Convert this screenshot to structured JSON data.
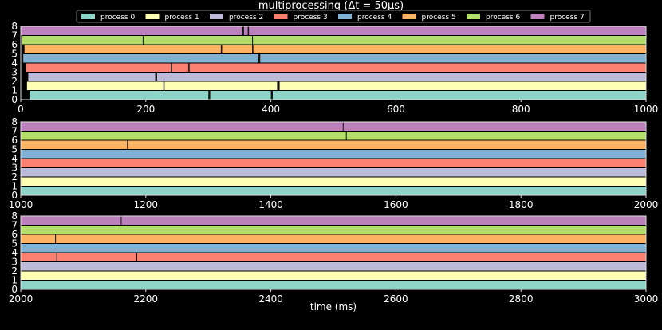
{
  "chart_data": {
    "type": "timeline",
    "title": "multiprocessing (Δt = 50μs)",
    "xlabel": "time (ms)",
    "legend": {
      "placement": "top-center",
      "entries": [
        "process 0",
        "process 1",
        "process 2",
        "process 3",
        "process 4",
        "process 5",
        "process 6",
        "process 7"
      ]
    },
    "colors": [
      "#8dd3c7",
      "#ffffb3",
      "#bebada",
      "#fb8072",
      "#80b1d3",
      "#fdb462",
      "#b3de69",
      "#bc80bd"
    ],
    "yticks": [
      "0",
      "1",
      "2",
      "3",
      "4",
      "5",
      "6",
      "7",
      "8"
    ],
    "panels": [
      {
        "xlim": [
          0,
          1000
        ],
        "xticks": [
          "0",
          "200",
          "400",
          "600",
          "800",
          "1000"
        ],
        "starts": [
          14,
          10,
          12,
          8,
          4,
          6,
          2,
          0
        ],
        "idle": [
          [
            0,
            300,
            3
          ],
          [
            0,
            400,
            3
          ],
          [
            1,
            410,
            4
          ],
          [
            1,
            228,
            2
          ],
          [
            2,
            215,
            3
          ],
          [
            3,
            240,
            2
          ],
          [
            3,
            268,
            2
          ],
          [
            4,
            380,
            3
          ],
          [
            5,
            370,
            2
          ],
          [
            5,
            320,
            2
          ],
          [
            6,
            195,
            1
          ],
          [
            6,
            370,
            1
          ],
          [
            7,
            354,
            3
          ],
          [
            7,
            363,
            2
          ]
        ]
      },
      {
        "xlim": [
          1000,
          2000
        ],
        "xticks": [
          "1000",
          "1200",
          "1400",
          "1600",
          "1800",
          "2000"
        ],
        "starts": [
          0,
          0,
          0,
          0,
          0,
          0,
          0,
          0
        ],
        "idle": [
          [
            7,
            1515,
            1
          ],
          [
            6,
            1520,
            1
          ],
          [
            5,
            1170,
            1
          ]
        ]
      },
      {
        "xlim": [
          2000,
          3000
        ],
        "xticks": [
          "2000",
          "2200",
          "2400",
          "2600",
          "2800",
          "3000"
        ],
        "starts": [
          0,
          0,
          0,
          0,
          0,
          0,
          0,
          0
        ],
        "idle": [
          [
            7,
            2160,
            1
          ],
          [
            3,
            2185,
            1
          ],
          [
            3,
            2057,
            1
          ],
          [
            5,
            2055,
            1
          ]
        ]
      }
    ]
  }
}
